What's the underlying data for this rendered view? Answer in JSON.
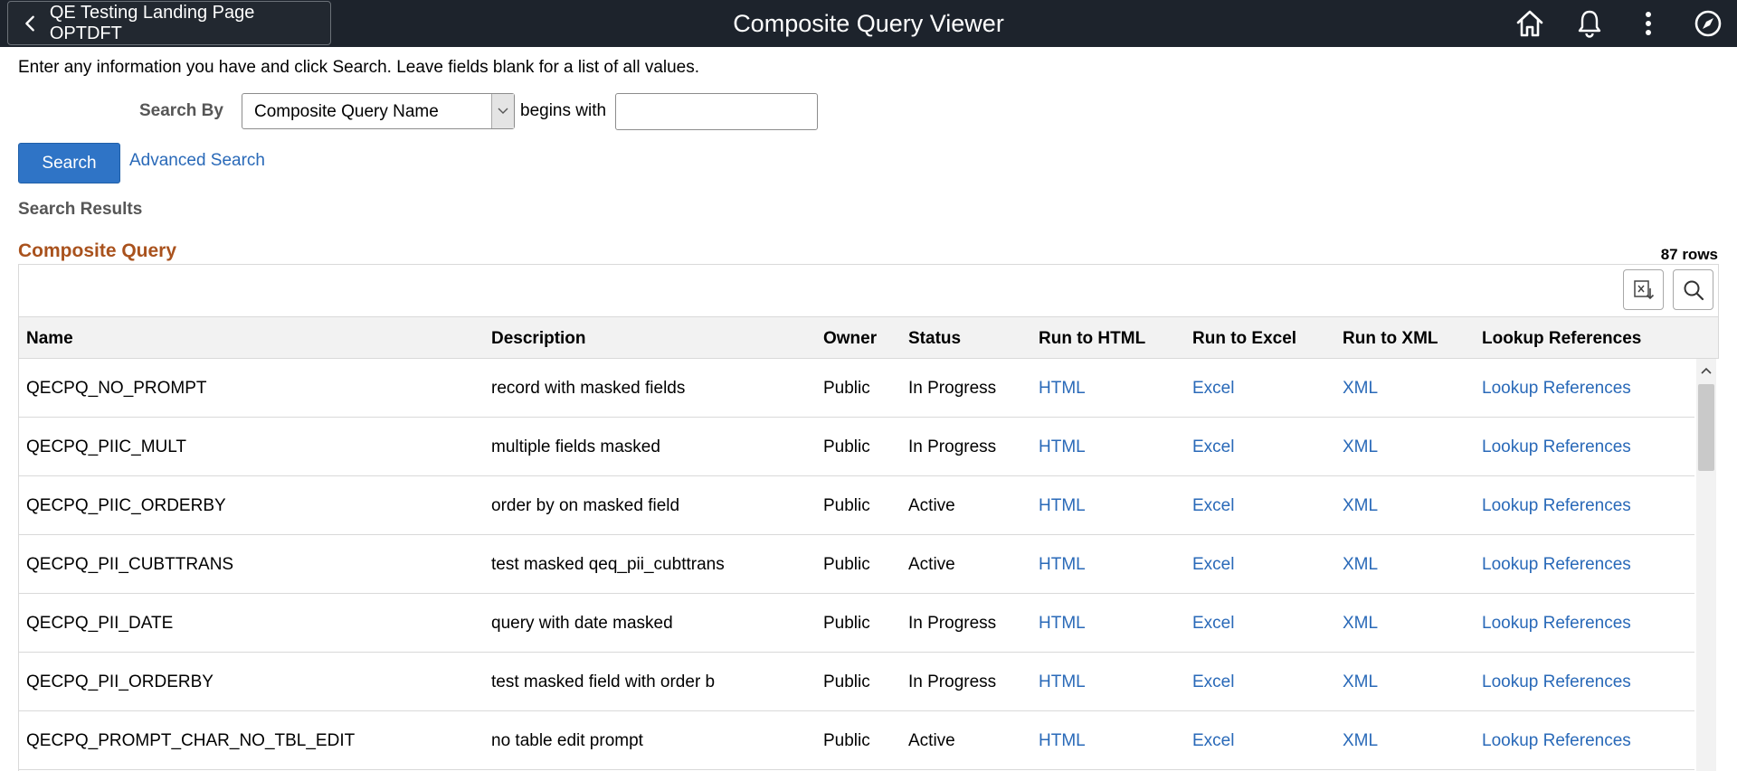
{
  "header": {
    "back_label": "QE Testing Landing Page OPTDFT",
    "title": "Composite Query Viewer",
    "icons": [
      "home-icon",
      "bell-icon",
      "more-vert-icon",
      "compass-icon"
    ],
    "bg_color": "#1d232c"
  },
  "search": {
    "instructions": "Enter any information you have and click Search. Leave fields blank for a list of all values.",
    "search_by_label": "Search By",
    "search_by_value": "Composite Query Name",
    "operator_label": "begins with",
    "input_value": "",
    "search_button": "Search",
    "advanced_link": "Advanced Search"
  },
  "results": {
    "label": "Search Results",
    "grid_title": "Composite Query",
    "row_count": "87 rows",
    "columns": [
      "Name",
      "Description",
      "Owner",
      "Status",
      "Run to HTML",
      "Run to Excel",
      "Run to XML",
      "Lookup References"
    ],
    "rows": [
      {
        "name": "QECPQ_NO_PROMPT",
        "description": "record with masked fields",
        "owner": "Public",
        "status": "In Progress",
        "html": "HTML",
        "excel": "Excel",
        "xml": "XML",
        "lookup": "Lookup References"
      },
      {
        "name": "QECPQ_PIIC_MULT",
        "description": "multiple fields masked",
        "owner": "Public",
        "status": "In Progress",
        "html": "HTML",
        "excel": "Excel",
        "xml": "XML",
        "lookup": "Lookup References"
      },
      {
        "name": "QECPQ_PIIC_ORDERBY",
        "description": "order by on masked field",
        "owner": "Public",
        "status": "Active",
        "html": "HTML",
        "excel": "Excel",
        "xml": "XML",
        "lookup": "Lookup References"
      },
      {
        "name": "QECPQ_PII_CUBTTRANS",
        "description": "test masked qeq_pii_cubttrans",
        "owner": "Public",
        "status": "Active",
        "html": "HTML",
        "excel": "Excel",
        "xml": "XML",
        "lookup": "Lookup References"
      },
      {
        "name": "QECPQ_PII_DATE",
        "description": "query with date masked",
        "owner": "Public",
        "status": "In Progress",
        "html": "HTML",
        "excel": "Excel",
        "xml": "XML",
        "lookup": "Lookup References"
      },
      {
        "name": "QECPQ_PII_ORDERBY",
        "description": "test masked field with order b",
        "owner": "Public",
        "status": "In Progress",
        "html": "HTML",
        "excel": "Excel",
        "xml": "XML",
        "lookup": "Lookup References"
      },
      {
        "name": "QECPQ_PROMPT_CHAR_NO_TBL_EDIT",
        "description": "no table edit prompt",
        "owner": "Public",
        "status": "Active",
        "html": "HTML",
        "excel": "Excel",
        "xml": "XML",
        "lookup": "Lookup References"
      }
    ]
  },
  "colors": {
    "link": "#2969b8",
    "primary_button": "#2f74c6",
    "grid_title": "#a9521d",
    "label_gray": "#565656"
  }
}
